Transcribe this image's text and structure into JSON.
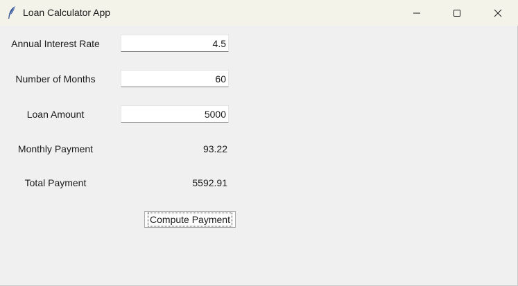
{
  "window": {
    "title": "Loan Calculator App",
    "icon": "feather-icon",
    "controls": [
      "minimize-icon",
      "maximize-icon",
      "close-icon"
    ]
  },
  "form": {
    "interest_rate": {
      "label": "Annual Interest Rate",
      "value": "4.5"
    },
    "months": {
      "label": "Number of Months",
      "value": "60"
    },
    "loan_amount": {
      "label": "Loan Amount",
      "value": "5000"
    },
    "monthly_payment": {
      "label": "Monthly Payment",
      "value": "93.22"
    },
    "total_payment": {
      "label": "Total Payment",
      "value": "5592.91"
    },
    "compute_label": "Compute Payment"
  }
}
